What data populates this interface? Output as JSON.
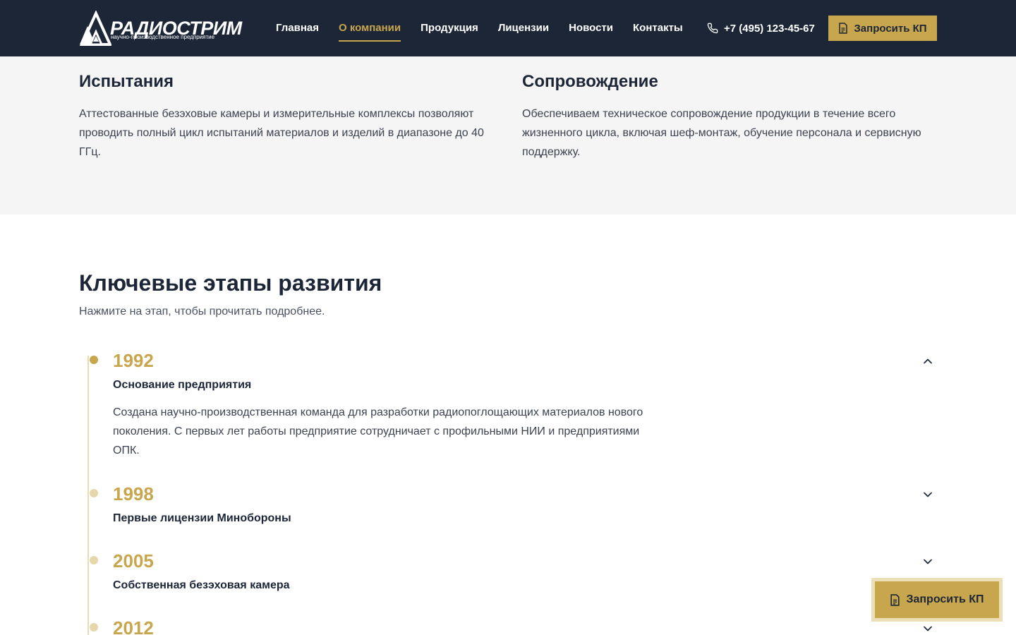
{
  "header": {
    "logo_text": "РАДИОСТРИМ",
    "logo_subtitle": "научно-производственное предприятие",
    "nav": [
      {
        "label": "Главная"
      },
      {
        "label": "О компании",
        "active": true
      },
      {
        "label": "Продукция"
      },
      {
        "label": "Лицензии"
      },
      {
        "label": "Новости"
      },
      {
        "label": "Контакты"
      }
    ],
    "phone": "+7 (495) 123-45-67",
    "cta_label": "Запросить КП"
  },
  "services": [
    {
      "title": "Испытания",
      "text": "Аттестованные безэховые камеры и измерительные комплексы позволяют проводить полный цикл испытаний материалов и изделий в диапазоне до 40 ГГц."
    },
    {
      "title": "Сопровождение",
      "text": "Обеспечиваем техническое сопровождение продукции в течение всего жизненного цикла, включая шеф-монтаж, обучение персонала и сервисную поддержку."
    }
  ],
  "timeline": {
    "title": "Ключевые этапы развития",
    "subtitle": "Нажмите на этап, чтобы прочитать подробнее.",
    "stages": [
      {
        "year": "1992",
        "title": "Основание предприятия",
        "description": "Создана научно-производственная команда для разработки радиопоглощающих материалов нового поколения. С первых лет работы предприятие сотрудничает с профильными НИИ и предприятиями ОПК.",
        "expanded": true
      },
      {
        "year": "1998",
        "title": "Первые лицензии Минобороны",
        "expanded": false
      },
      {
        "year": "2005",
        "title": "Собственная безэховая камера",
        "expanded": false
      },
      {
        "year": "2012",
        "title": "",
        "expanded": false
      }
    ]
  },
  "floating_cta": {
    "label": "Запросить КП"
  },
  "colors": {
    "header_bg": "#1c2637",
    "accent": "#c8a64e",
    "section_bg": "#f5f5f5",
    "text": "#1c2637"
  },
  "icons": {
    "phone": "phone-icon",
    "document": "document-icon",
    "chevron_up": "chevron-up-icon",
    "chevron_down": "chevron-down-icon"
  }
}
